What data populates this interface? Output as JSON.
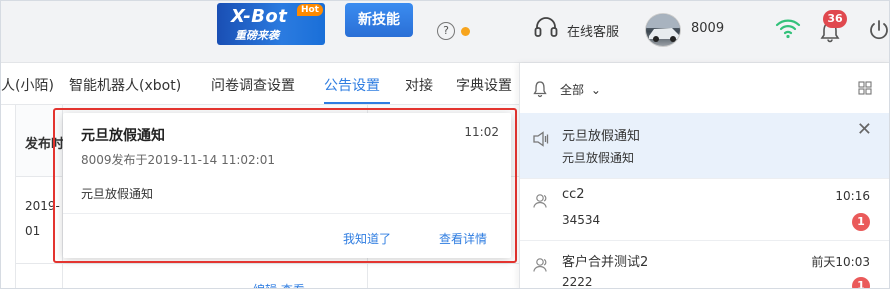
{
  "topbar": {
    "xbot_title": "X-Bot",
    "xbot_subtitle": "重磅来袭",
    "xbot_hot": "Hot",
    "new_skill": "新技能",
    "help_label": "?",
    "service_label": "在线客服",
    "user_id": "8009",
    "bell_badge": "36"
  },
  "tabs": [
    {
      "label": "人(小陌)",
      "active": false
    },
    {
      "label": "智能机器人(xbot)",
      "active": false
    },
    {
      "label": "问卷调查设置",
      "active": false
    },
    {
      "label": "公告设置",
      "active": true
    },
    {
      "label": "对接",
      "active": false
    },
    {
      "label": "字典设置",
      "active": false
    }
  ],
  "background_table": {
    "header": "发布时",
    "cell_line1": "2019-",
    "cell_line2": "01",
    "links": "编辑  查看"
  },
  "notice_popup": {
    "title": "元旦放假通知",
    "time": "11:02",
    "meta": "8009发布于2019-11-14 11:02:01",
    "body": "元旦放假通知",
    "ack_button": "我知道了",
    "detail_button": "查看详情"
  },
  "panel": {
    "filter_label": "全部",
    "items": [
      {
        "title": "元旦放假通知",
        "subtitle": "元旦放假通知",
        "time": "",
        "badge": "",
        "type": "announcement"
      },
      {
        "title": "cc2",
        "subtitle": "34534",
        "time": "10:16",
        "badge": "1",
        "type": "contact"
      },
      {
        "title": "客户合并测试2",
        "subtitle": "2222",
        "time": "前天10:03",
        "badge": "1",
        "type": "contact"
      }
    ]
  },
  "colors": {
    "accent": "#2f7de1",
    "highlight_outline": "#e3342f",
    "badge_red": "#e0484e"
  }
}
